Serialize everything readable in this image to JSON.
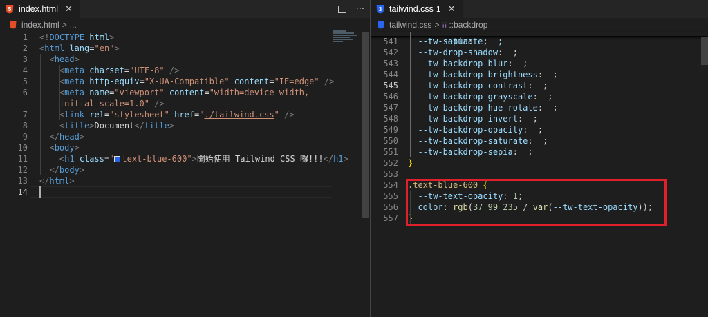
{
  "left_editor": {
    "tab": {
      "label": "index.html",
      "close_glyph": "✕",
      "icon": "html5-icon"
    },
    "actions": {
      "split_icon": "split-editor-icon",
      "more_glyph": "···"
    },
    "breadcrumb": {
      "file": "index.html",
      "sep": ">",
      "rest": "..."
    },
    "lines": [
      {
        "num": "1",
        "tokens": [
          [
            "t-bracket",
            "<!"
          ],
          [
            "t-tag",
            "DOCTYPE "
          ],
          [
            "t-attr",
            "html"
          ],
          [
            "t-bracket",
            ">"
          ]
        ]
      },
      {
        "num": "2",
        "tokens": [
          [
            "t-bracket",
            "<"
          ],
          [
            "t-tag",
            "html "
          ],
          [
            "t-attr",
            "lang"
          ],
          [
            "t-text",
            "="
          ],
          [
            "t-str",
            "\"en\""
          ],
          [
            "t-bracket",
            ">"
          ]
        ]
      },
      {
        "num": "3",
        "tokens": [
          [
            "t-bracket",
            "  <"
          ],
          [
            "t-tag",
            "head"
          ],
          [
            "t-bracket",
            ">"
          ]
        ]
      },
      {
        "num": "4",
        "tokens": [
          [
            "t-bracket",
            "    <"
          ],
          [
            "t-tag",
            "meta "
          ],
          [
            "t-attr",
            "charset"
          ],
          [
            "t-text",
            "="
          ],
          [
            "t-str",
            "\"UTF-8\""
          ],
          [
            "t-bracket",
            " />"
          ]
        ]
      },
      {
        "num": "5",
        "tokens": [
          [
            "t-bracket",
            "    <"
          ],
          [
            "t-tag",
            "meta "
          ],
          [
            "t-attr",
            "http-equiv"
          ],
          [
            "t-text",
            "="
          ],
          [
            "t-str",
            "\"X-UA-Compatible\""
          ],
          [
            "t-text",
            " "
          ],
          [
            "t-attr",
            "content"
          ],
          [
            "t-text",
            "="
          ],
          [
            "t-str",
            "\"IE=edge\""
          ],
          [
            "t-bracket",
            " />"
          ]
        ]
      },
      {
        "num": "6",
        "tokens": [
          [
            "t-bracket",
            "    <"
          ],
          [
            "t-tag",
            "meta "
          ],
          [
            "t-attr",
            "name"
          ],
          [
            "t-text",
            "="
          ],
          [
            "t-str",
            "\"viewport\""
          ],
          [
            "t-text",
            " "
          ],
          [
            "t-attr",
            "content"
          ],
          [
            "t-text",
            "="
          ],
          [
            "t-str",
            "\"width=device-width,"
          ]
        ]
      },
      {
        "num": "",
        "tokens": [
          [
            "t-str",
            "    initial-scale=1.0\""
          ],
          [
            "t-bracket",
            " />"
          ]
        ]
      },
      {
        "num": "7",
        "tokens": [
          [
            "t-bracket",
            "    <"
          ],
          [
            "t-tag",
            "link "
          ],
          [
            "t-attr",
            "rel"
          ],
          [
            "t-text",
            "="
          ],
          [
            "t-str",
            "\"stylesheet\""
          ],
          [
            "t-text",
            " "
          ],
          [
            "t-attr",
            "href"
          ],
          [
            "t-text",
            "="
          ],
          [
            "t-str",
            "\""
          ],
          [
            "t-str link-underline",
            "./tailwind.css"
          ],
          [
            "t-str",
            "\""
          ],
          [
            "t-bracket",
            " />"
          ]
        ]
      },
      {
        "num": "8",
        "tokens": [
          [
            "t-bracket",
            "    <"
          ],
          [
            "t-tag",
            "title"
          ],
          [
            "t-bracket",
            ">"
          ],
          [
            "t-text",
            "Document"
          ],
          [
            "t-bracket",
            "</"
          ],
          [
            "t-tag",
            "title"
          ],
          [
            "t-bracket",
            ">"
          ]
        ]
      },
      {
        "num": "9",
        "tokens": [
          [
            "t-bracket",
            "  </"
          ],
          [
            "t-tag",
            "head"
          ],
          [
            "t-bracket",
            ">"
          ]
        ]
      },
      {
        "num": "10",
        "tokens": [
          [
            "t-bracket",
            "  <"
          ],
          [
            "t-tag",
            "body"
          ],
          [
            "t-bracket",
            ">"
          ]
        ]
      },
      {
        "num": "11",
        "tokens": [
          [
            "t-bracket",
            "    <"
          ],
          [
            "t-tag",
            "h1 "
          ],
          [
            "t-attr",
            "class"
          ],
          [
            "t-text",
            "="
          ],
          [
            "t-str",
            "\""
          ],
          [
            "swatch",
            ""
          ],
          [
            "t-str",
            "text-blue-600\""
          ],
          [
            "t-bracket",
            ">"
          ],
          [
            "t-text",
            "開始使用 Tailwind CSS 囉!!!"
          ],
          [
            "t-bracket",
            "</"
          ],
          [
            "t-tag",
            "h1"
          ],
          [
            "t-bracket",
            ">"
          ]
        ]
      },
      {
        "num": "12",
        "tokens": [
          [
            "t-bracket",
            "  </"
          ],
          [
            "t-tag",
            "body"
          ],
          [
            "t-bracket",
            ">"
          ]
        ]
      },
      {
        "num": "13",
        "tokens": [
          [
            "t-bracket",
            "</"
          ],
          [
            "t-tag",
            "html"
          ],
          [
            "t-bracket",
            ">"
          ]
        ]
      },
      {
        "num": "14",
        "tokens": []
      }
    ]
  },
  "right_editor": {
    "tab": {
      "label": "tailwind.css",
      "badge": "1",
      "close_glyph": "✕",
      "icon": "css3-icon"
    },
    "breadcrumb": {
      "file": "tailwind.css",
      "sep": ">",
      "symbol_glyph": "⁝⁝",
      "symbol": "::backdrop"
    },
    "partial_line": "  --tw-saturate:  ;",
    "lines": [
      {
        "num": "541",
        "tokens": [
          [
            "t-prop",
            "  --tw-sepia"
          ],
          [
            "t-text",
            ":  ;"
          ]
        ]
      },
      {
        "num": "542",
        "tokens": [
          [
            "t-prop",
            "  --tw-drop-shadow"
          ],
          [
            "t-text",
            ":  ;"
          ]
        ]
      },
      {
        "num": "543",
        "tokens": [
          [
            "t-prop",
            "  --tw-backdrop-blur"
          ],
          [
            "t-text",
            ":  ;"
          ]
        ]
      },
      {
        "num": "544",
        "tokens": [
          [
            "t-prop",
            "  --tw-backdrop-brightness"
          ],
          [
            "t-text",
            ":  ;"
          ]
        ]
      },
      {
        "num": "545",
        "tokens": [
          [
            "t-prop",
            "  --tw-backdrop-contrast"
          ],
          [
            "t-text",
            ":  ;"
          ]
        ]
      },
      {
        "num": "546",
        "tokens": [
          [
            "t-prop",
            "  --tw-backdrop-grayscale"
          ],
          [
            "t-text",
            ":  ;"
          ]
        ]
      },
      {
        "num": "547",
        "tokens": [
          [
            "t-prop",
            "  --tw-backdrop-hue-rotate"
          ],
          [
            "t-text",
            ":  ;"
          ]
        ]
      },
      {
        "num": "548",
        "tokens": [
          [
            "t-prop",
            "  --tw-backdrop-invert"
          ],
          [
            "t-text",
            ":  ;"
          ]
        ]
      },
      {
        "num": "549",
        "tokens": [
          [
            "t-prop",
            "  --tw-backdrop-opacity"
          ],
          [
            "t-text",
            ":  ;"
          ]
        ]
      },
      {
        "num": "550",
        "tokens": [
          [
            "t-prop",
            "  --tw-backdrop-saturate"
          ],
          [
            "t-text",
            ":  ;"
          ]
        ]
      },
      {
        "num": "551",
        "tokens": [
          [
            "t-prop",
            "  --tw-backdrop-sepia"
          ],
          [
            "t-text",
            ":  ;"
          ]
        ]
      },
      {
        "num": "552",
        "tokens": [
          [
            "t-brace",
            "}"
          ]
        ]
      },
      {
        "num": "553",
        "tokens": []
      },
      {
        "num": "554",
        "tokens": [
          [
            "t-sel",
            ".text-blue-600"
          ],
          [
            "t-text",
            " "
          ],
          [
            "t-brace",
            "{"
          ]
        ]
      },
      {
        "num": "555",
        "tokens": [
          [
            "t-prop",
            "  --tw-text-opacity"
          ],
          [
            "t-text",
            ": "
          ],
          [
            "t-num",
            "1"
          ],
          [
            "t-text",
            ";"
          ]
        ]
      },
      {
        "num": "556",
        "tokens": [
          [
            "t-prop",
            "  color"
          ],
          [
            "t-text",
            ": "
          ],
          [
            "t-fn",
            "rgb"
          ],
          [
            "t-text",
            "("
          ],
          [
            "t-num",
            "37 99 235"
          ],
          [
            "t-text",
            " / "
          ],
          [
            "t-fn",
            "var"
          ],
          [
            "t-text",
            "("
          ],
          [
            "t-prop",
            "--tw-text-opacity"
          ],
          [
            "t-text",
            "));"
          ]
        ]
      },
      {
        "num": "557",
        "tokens": [
          [
            "t-brace",
            "}"
          ]
        ]
      }
    ]
  }
}
